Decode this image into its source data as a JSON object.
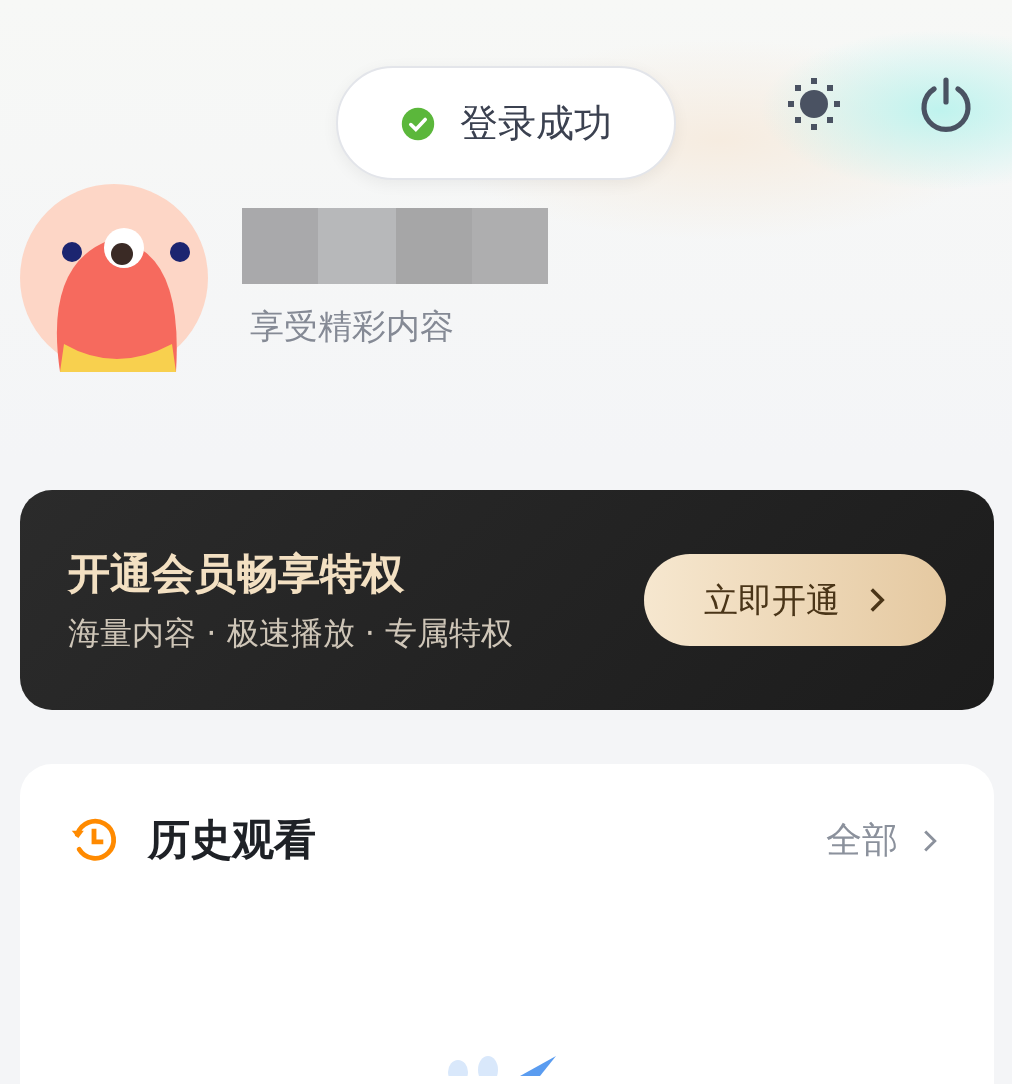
{
  "toast": {
    "message": "登录成功"
  },
  "profile": {
    "subtitle": "享受精彩内容"
  },
  "vip_card": {
    "title": "开通会员畅享特权",
    "subtitle": "海量内容 · 极速播放 · 专属特权",
    "button": "立即开通"
  },
  "history": {
    "title": "历史观看",
    "link": "全部"
  }
}
